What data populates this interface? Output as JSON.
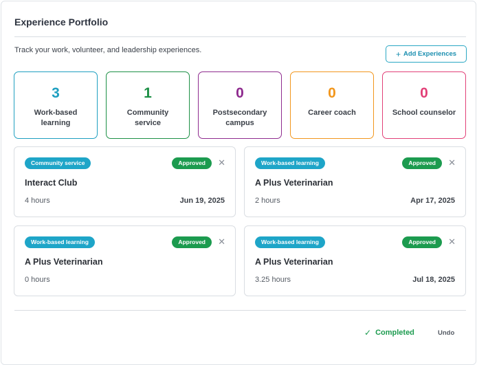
{
  "header": {
    "title": "Experience Portfolio",
    "subtitle": "Track your work, volunteer, and leadership experiences.",
    "add_button_label": "Add Experiences"
  },
  "stats": [
    {
      "count": "3",
      "label": "Work-based learning",
      "color": "#1e9fc0"
    },
    {
      "count": "1",
      "label": "Community service",
      "color": "#1c8f45"
    },
    {
      "count": "0",
      "label": "Postsecondary campus",
      "color": "#8e2a8e"
    },
    {
      "count": "0",
      "label": "Career coach",
      "color": "#f2961c"
    },
    {
      "count": "0",
      "label": "School counselor",
      "color": "#e23f77"
    }
  ],
  "experiences": [
    {
      "category": "Community service",
      "status": "Approved",
      "name": "Interact Club",
      "hours": "4 hours",
      "date": "Jun 19, 2025"
    },
    {
      "category": "Work-based learning",
      "status": "Approved",
      "name": "A Plus Veterinarian",
      "hours": "2 hours",
      "date": "Apr 17, 2025"
    },
    {
      "category": "Work-based learning",
      "status": "Approved",
      "name": "A Plus Veterinarian",
      "hours": "0 hours",
      "date": ""
    },
    {
      "category": "Work-based learning",
      "status": "Approved",
      "name": "A Plus Veterinarian",
      "hours": "3.25 hours",
      "date": "Jul 18, 2025"
    }
  ],
  "footer": {
    "completed_label": "Completed",
    "undo_label": "Undo"
  },
  "colors": {
    "accent": "#1b8fb0",
    "tag_bg": "#1ea5c8",
    "approved_bg": "#1c9b4f"
  }
}
